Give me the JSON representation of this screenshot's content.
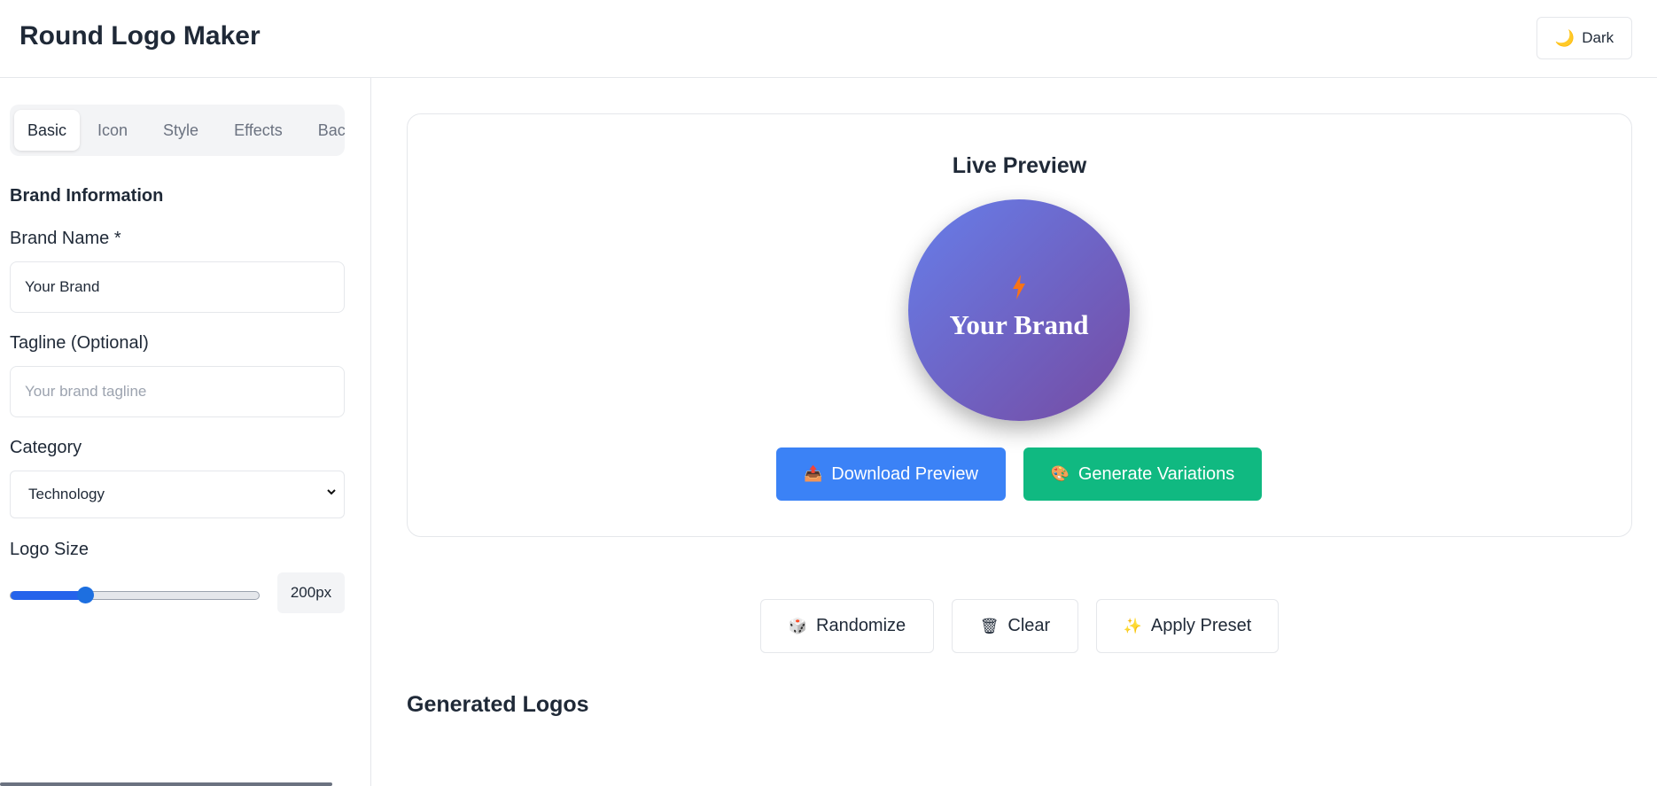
{
  "app": {
    "title": "Round Logo Maker"
  },
  "header": {
    "theme_button": {
      "icon": "moon-icon",
      "label": "Dark"
    }
  },
  "sidebar": {
    "tabs": [
      {
        "label": "Basic",
        "active": true
      },
      {
        "label": "Icon",
        "active": false
      },
      {
        "label": "Style",
        "active": false
      },
      {
        "label": "Effects",
        "active": false
      },
      {
        "label": "Background",
        "active": false
      }
    ],
    "section_title": "Brand Information",
    "brand_name": {
      "label": "Brand Name *",
      "value": "Your Brand"
    },
    "tagline": {
      "label": "Tagline (Optional)",
      "value": "",
      "placeholder": "Your brand tagline"
    },
    "category": {
      "label": "Category",
      "value": "Technology"
    },
    "logo_size": {
      "label": "Logo Size",
      "value_text": "200px",
      "fraction": 0.3
    }
  },
  "preview": {
    "title": "Live Preview",
    "logo": {
      "icon": "lightning-bolt-icon",
      "text": "Your Brand",
      "gradient_start": "#667eea",
      "gradient_end": "#764ba2"
    },
    "download_button": {
      "icon": "outbox-tray-icon",
      "label": "Download Preview",
      "color": "#3b82f6"
    },
    "variations_button": {
      "icon": "palette-icon",
      "label": "Generate Variations",
      "color": "#10b981"
    }
  },
  "actions": {
    "randomize": {
      "icon": "dice-icon",
      "label": "Randomize"
    },
    "clear": {
      "icon": "wastebasket-icon",
      "label": "Clear"
    },
    "apply_preset": {
      "icon": "sparkles-icon",
      "label": "Apply Preset"
    }
  },
  "generated": {
    "title": "Generated Logos"
  }
}
